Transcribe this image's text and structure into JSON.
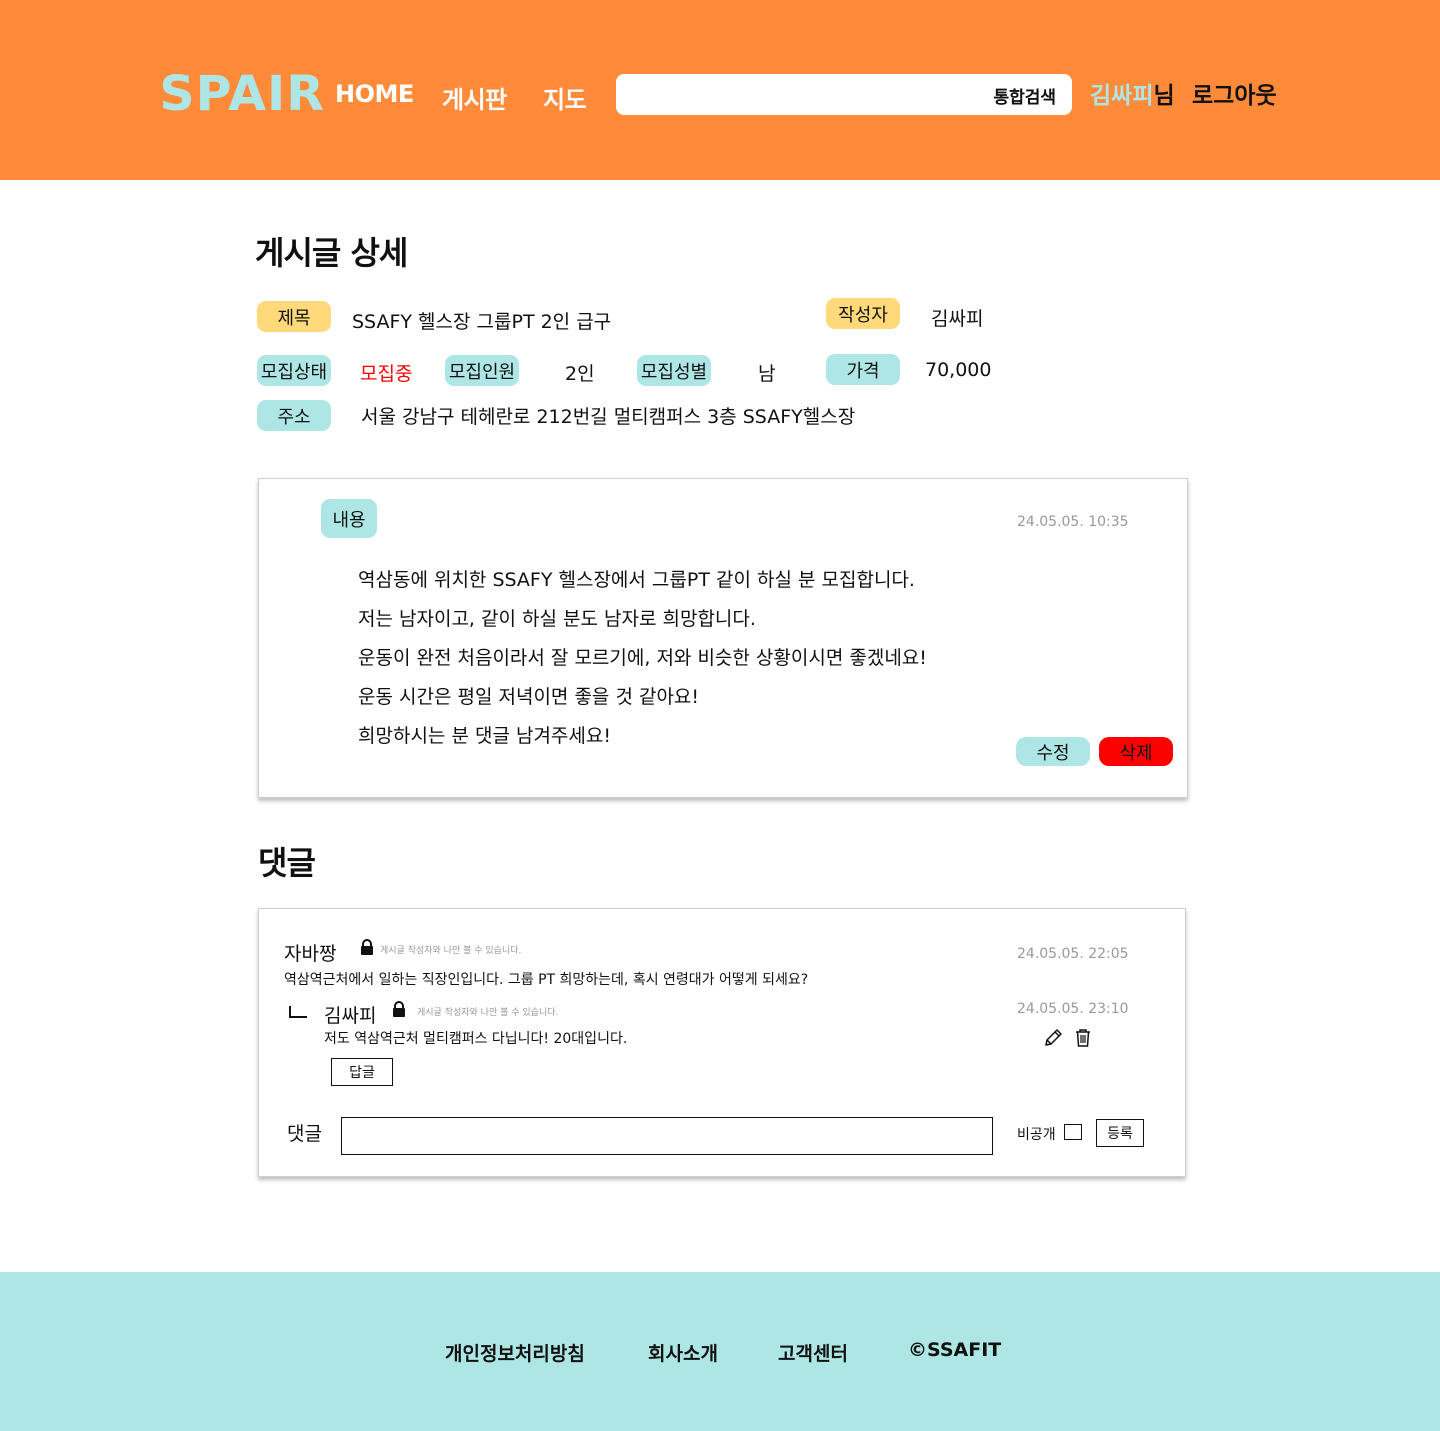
{
  "header": {
    "logo": "SPAIR",
    "nav": [
      "HOME",
      "게시판",
      "지도"
    ],
    "search_placeholder": "",
    "search_button": "통합검색",
    "user_name": "김싸피",
    "user_suffix": "님",
    "logout": "로그아웃",
    "colors": {
      "header_bg": "#ff8a3a",
      "logo": "#aee6e6"
    }
  },
  "detail": {
    "page_title": "게시글 상세",
    "title_label": "제목",
    "title_value": "SSAFY 헬스장 그룹PT 2인 급구",
    "author_label": "작성자",
    "author_value": "김싸피",
    "status_label": "모집상태",
    "status_value": "모집중",
    "count_label": "모집인원",
    "count_value": "2인",
    "gender_label": "모집성별",
    "gender_value": "남",
    "price_label": "가격",
    "price_value": "70,000",
    "address_label": "주소",
    "address_value": "서울 강남구 테헤란로 212번길 멀티캠퍼스 3층 SSAFY헬스장"
  },
  "content": {
    "label": "내용",
    "date": "24.05.05. 10:35",
    "lines": [
      "역삼동에 위치한 SSAFY 헬스장에서 그룹PT 같이 하실 분 모집합니다.",
      "저는 남자이고, 같이 하실 분도 남자로 희망합니다.",
      "운동이 완전 처음이라서 잘 모르기에, 저와 비슷한 상황이시면 좋겠네요!",
      "운동 시간은 평일 저녁이면 좋을 것 같아요!",
      "희망하시는 분 댓글 남겨주세요!"
    ],
    "edit_button": "수정",
    "delete_button": "삭제"
  },
  "comments": {
    "title": "댓글",
    "items": [
      {
        "author": "자바짱",
        "private_note": "게시글 작성자와 나만 볼 수 있습니다.",
        "date": "24.05.05. 22:05",
        "text": "역삼역근처에서 일하는 직장인입니다. 그룹 PT 희망하는데, 혹시 연령대가 어떻게 되세요?"
      },
      {
        "author": "김싸피",
        "private_note": "게시글 작성자와 나만 볼 수 있습니다.",
        "date": "24.05.05. 23:10",
        "text": "저도 역삼역근처 멀티캠퍼스 다닙니다! 20대입니다."
      }
    ],
    "reply_button": "답글",
    "input_label": "댓글",
    "input_value": "",
    "private_label": "비공개",
    "submit_button": "등록"
  },
  "footer": {
    "links": [
      "개인정보처리방침",
      "회사소개",
      "고객센터",
      "©SSAFIT"
    ]
  }
}
